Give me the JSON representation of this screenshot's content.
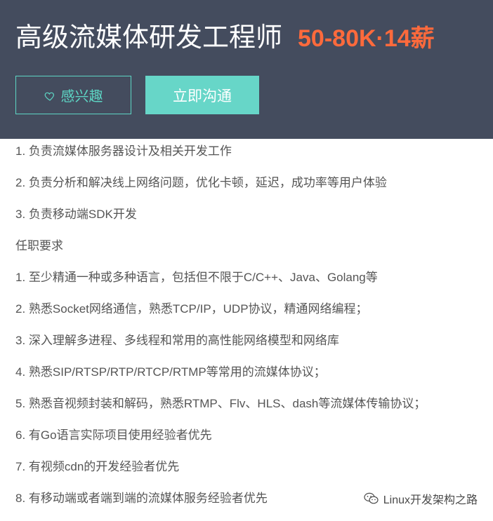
{
  "header": {
    "job_title": "高级流媒体研发工程师",
    "salary": "50-80K·14薪",
    "interest_button_label": "感兴趣",
    "chat_button_label": "立即沟通",
    "colors": {
      "background": "#444c5e",
      "salary": "#ff6a3c",
      "accent": "#67d6c8"
    }
  },
  "description": {
    "lines": [
      "1. 负责流媒体服务器设计及相关开发工作",
      "2. 负责分析和解决线上网络问题，优化卡顿，延迟，成功率等用户体验",
      "3. 负责移动端SDK开发",
      "任职要求",
      "1. 至少精通一种或多种语言，包括但不限于C/C++、Java、Golang等",
      "2. 熟悉Socket网络通信，熟悉TCP/IP，UDP协议，精通网络编程；",
      "3. 深入理解多进程、多线程和常用的高性能网络模型和网络库",
      "4. 熟悉SIP/RTSP/RTP/RTCP/RTMP等常用的流媒体协议；",
      "5. 熟悉音视频封装和解码，熟悉RTMP、Flv、HLS、dash等流媒体传输协议；",
      "6. 有Go语言实际项目使用经验者优先",
      "7. 有视频cdn的开发经验者优先",
      "8. 有移动端或者端到端的流媒体服务经验者优先"
    ]
  },
  "watermark": {
    "text": "Linux开发架构之路",
    "icon": "wechat-icon"
  }
}
